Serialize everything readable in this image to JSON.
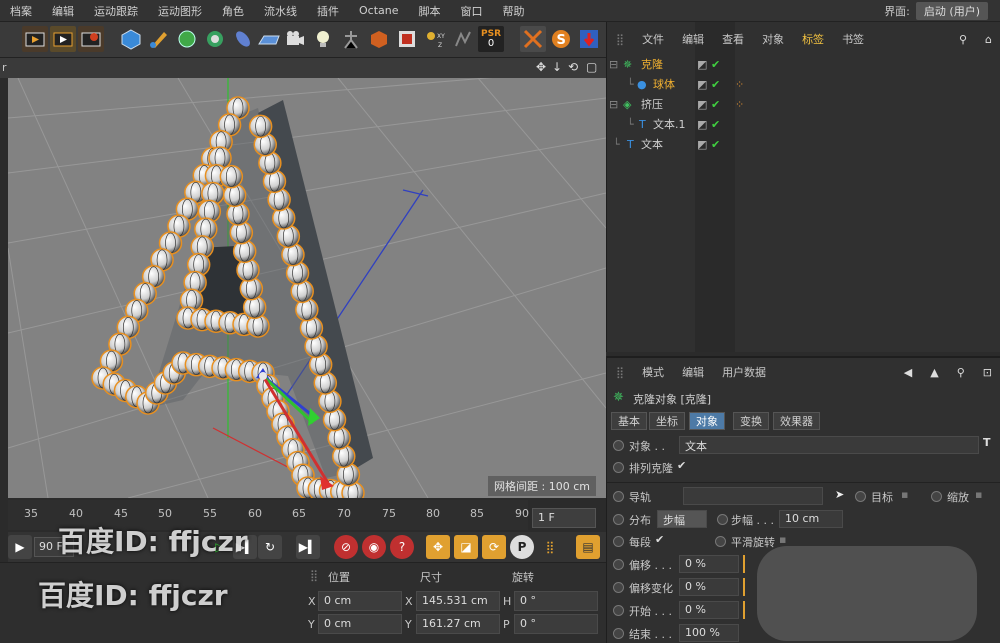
{
  "menubar": {
    "items": [
      "档案",
      "编辑",
      "运动跟踪",
      "运动图形",
      "角色",
      "流水线",
      "插件",
      "Octane",
      "脚本",
      "窗口",
      "帮助"
    ],
    "layout_label": "界面:",
    "layout_value": "启动 (用户)"
  },
  "toolbar": {
    "psr_label": "PSR",
    "psr_value": "0"
  },
  "viewport": {
    "header_label": "r",
    "grid_spacing": "网格间距 : 100 cm"
  },
  "timeline": {
    "ticks": [
      "35",
      "40",
      "45",
      "50",
      "55",
      "60",
      "65",
      "70",
      "75",
      "80",
      "85",
      "90"
    ],
    "current_frame": "1 F",
    "end_frame": "90 F"
  },
  "coords": {
    "headers": [
      "位置",
      "尺寸",
      "旋转"
    ],
    "rows": [
      {
        "pos_axis": "X",
        "pos": "0 cm",
        "size_axis": "X",
        "size": "145.531 cm",
        "rot_axis": "H",
        "rot": "0 °"
      },
      {
        "pos_axis": "Y",
        "pos": "0 cm",
        "size_axis": "Y",
        "size": "161.27 cm",
        "rot_axis": "P",
        "rot": "0 °"
      }
    ]
  },
  "object_manager": {
    "menu": [
      "文件",
      "编辑",
      "查看",
      "对象",
      "标签",
      "书签"
    ],
    "objects": [
      {
        "name": "克隆",
        "color": "#f0b030"
      },
      {
        "name": "球体",
        "color": "#f0b030"
      },
      {
        "name": "挤压",
        "color": "#d0d0d0"
      },
      {
        "name": "文本.1",
        "color": "#d0d0d0"
      },
      {
        "name": "文本",
        "color": "#d0d0d0"
      }
    ]
  },
  "attributes": {
    "menu": [
      "模式",
      "编辑",
      "用户数据"
    ],
    "object_title": "克隆对象 [克隆]",
    "tabs": [
      "基本",
      "坐标",
      "对象",
      "变换",
      "效果器"
    ],
    "active_tab": "对象",
    "object_label": "对象 . .",
    "object_value": "文本",
    "arrange_clones_label": "排列克隆",
    "rail_label": "导轨",
    "target_label": "目标",
    "scale_label": "缩放",
    "distribute_label": "分布",
    "distribute_value": "步幅",
    "step_label": "步幅 . . .",
    "step_value": "10 cm",
    "equal_label": "每段",
    "smooth_rotation_label": "平滑旋转",
    "offset_label": "偏移 . . .",
    "offset_value": "0 %",
    "offset_var_label": "偏移变化",
    "offset_var_value": "0 %",
    "start_label": "开始 . . .",
    "start_value": "0 %",
    "end_label": "结束 . . .",
    "end_value": "100 %"
  },
  "watermarks": [
    "百度ID: ffjczr",
    "百度ID: ffjczr"
  ]
}
